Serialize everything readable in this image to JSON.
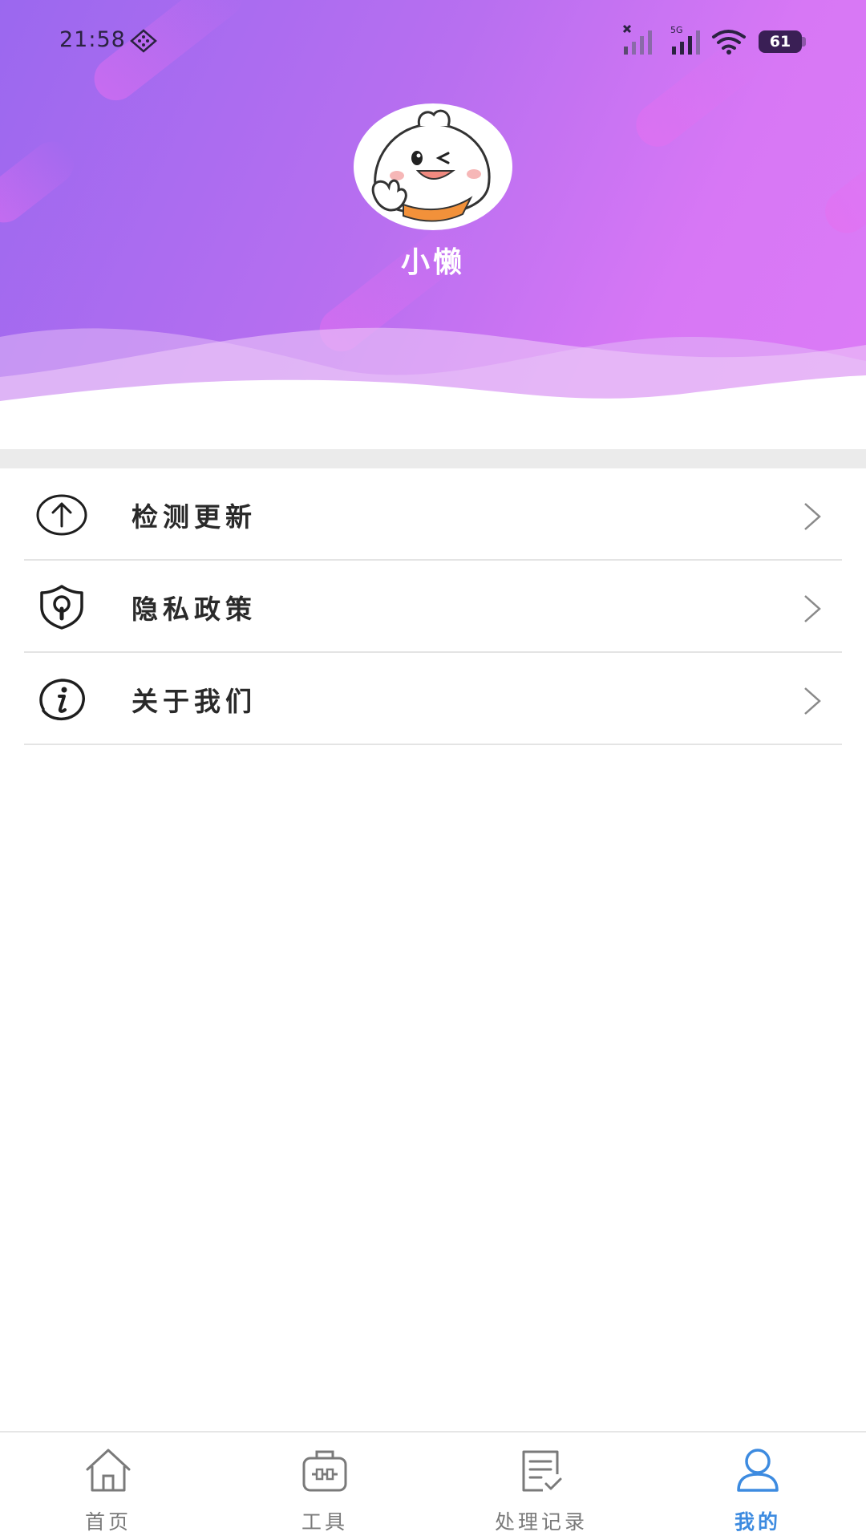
{
  "status_bar": {
    "time": "21:58",
    "battery_level": "61",
    "icons": [
      "app-notification-icon",
      "signal-no-service-icon",
      "signal-5g-icon",
      "wifi-icon",
      "battery-icon"
    ],
    "network_label": "5G"
  },
  "profile": {
    "user_name": "小懒",
    "avatar_icon": "bun-mascot-avatar"
  },
  "menu": {
    "items": [
      {
        "label": "检测更新",
        "icon": "upload-arrow-icon"
      },
      {
        "label": "隐私政策",
        "icon": "shield-lock-icon"
      },
      {
        "label": "关于我们",
        "icon": "info-icon"
      }
    ],
    "chevron_icon": "chevron-right-icon"
  },
  "bottom_nav": {
    "items": [
      {
        "label": "首页",
        "icon": "home-icon"
      },
      {
        "label": "工具",
        "icon": "toolbox-icon"
      },
      {
        "label": "处理记录",
        "icon": "record-list-icon"
      },
      {
        "label": "我的",
        "icon": "user-icon"
      }
    ],
    "active_index": 3
  },
  "colors": {
    "gradient_start": "#9b68ef",
    "gradient_end": "#dc7bf6",
    "active_tab": "#3d8be0",
    "inactive_tab": "#7a7a7a"
  }
}
